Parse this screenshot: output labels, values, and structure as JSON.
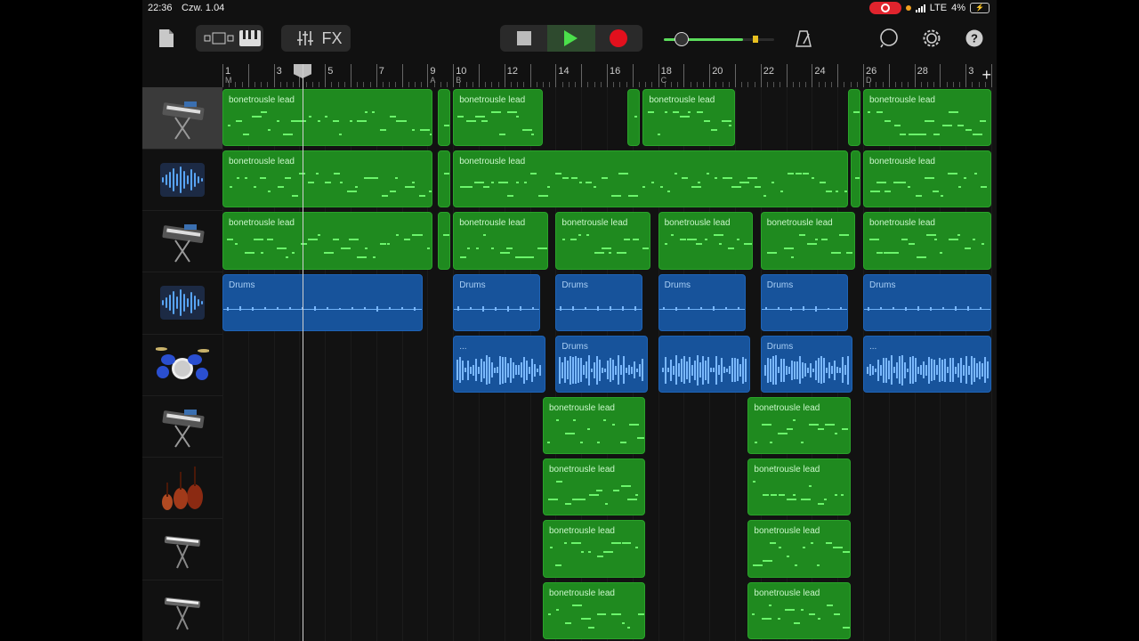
{
  "status": {
    "time": "22:36",
    "date": "Czw. 1.04",
    "network": "LTE",
    "battery": "4%"
  },
  "toolbar": {
    "fx_label": "FX",
    "volume_level": 0.72,
    "accent_color": "#3ee03e",
    "record_color": "#e3101d"
  },
  "ruler": {
    "bars": [
      "1",
      "3",
      "5",
      "7",
      "9",
      "10",
      "12",
      "14",
      "16",
      "18",
      "20",
      "22",
      "24",
      "26",
      "28",
      "3"
    ],
    "markers": [
      "M",
      "A",
      "B",
      "C",
      "D"
    ],
    "add_label": "+"
  },
  "tracks": [
    {
      "instrument_icon": "synth-keyboard-icon",
      "selected": true
    },
    {
      "instrument_icon": "audio-waveform-icon"
    },
    {
      "instrument_icon": "synth-keyboard-icon"
    },
    {
      "instrument_icon": "audio-waveform-icon"
    },
    {
      "instrument_icon": "drum-kit-icon"
    },
    {
      "instrument_icon": "synth-keyboard-icon"
    },
    {
      "instrument_icon": "string-ensemble-icon"
    },
    {
      "instrument_icon": "keyboard-stand-icon"
    },
    {
      "instrument_icon": "keyboard-stand-icon"
    }
  ],
  "regions": [
    {
      "track": 0,
      "name": "bonetrousle lead",
      "type": "midi",
      "start": 1,
      "end": 9.2
    },
    {
      "track": 0,
      "name": "",
      "type": "midi",
      "start": 9.4,
      "end": 9.9
    },
    {
      "track": 0,
      "name": "bonetrousle lead",
      "type": "midi",
      "start": 10,
      "end": 13.5
    },
    {
      "track": 0,
      "name": "",
      "type": "midi",
      "start": 16.8,
      "end": 17.3
    },
    {
      "track": 0,
      "name": "bonetrousle lead",
      "type": "midi",
      "start": 17.4,
      "end": 21
    },
    {
      "track": 0,
      "name": "",
      "type": "midi",
      "start": 25.4,
      "end": 25.9
    },
    {
      "track": 0,
      "name": "bonetrousle lead",
      "type": "midi",
      "start": 26,
      "end": 31
    },
    {
      "track": 1,
      "name": "bonetrousle lead",
      "type": "midi",
      "start": 1,
      "end": 9.2
    },
    {
      "track": 1,
      "name": "",
      "type": "midi",
      "start": 9.4,
      "end": 9.9
    },
    {
      "track": 1,
      "name": "bonetrousle lead",
      "type": "midi",
      "start": 10,
      "end": 25.4
    },
    {
      "track": 1,
      "name": "",
      "type": "midi",
      "start": 25.5,
      "end": 25.9
    },
    {
      "track": 1,
      "name": "bonetrousle lead",
      "type": "midi",
      "start": 26,
      "end": 31
    },
    {
      "track": 2,
      "name": "bonetrousle lead",
      "type": "midi",
      "start": 1,
      "end": 9.2
    },
    {
      "track": 2,
      "name": "",
      "type": "midi",
      "start": 9.4,
      "end": 9.9
    },
    {
      "track": 2,
      "name": "bonetrousle lead",
      "type": "midi",
      "start": 10,
      "end": 13.7
    },
    {
      "track": 2,
      "name": "bonetrousle lead",
      "type": "midi",
      "start": 14,
      "end": 17.7
    },
    {
      "track": 2,
      "name": "bonetrousle lead",
      "type": "midi",
      "start": 18,
      "end": 21.7
    },
    {
      "track": 2,
      "name": "bonetrousle lead",
      "type": "midi",
      "start": 22,
      "end": 25.7
    },
    {
      "track": 2,
      "name": "bonetrousle lead",
      "type": "midi",
      "start": 26,
      "end": 31
    },
    {
      "track": 3,
      "name": "Drums",
      "type": "drum",
      "style": "flat",
      "start": 1,
      "end": 8.8
    },
    {
      "track": 3,
      "name": "Drums",
      "type": "drum",
      "style": "flat",
      "start": 10,
      "end": 13.4
    },
    {
      "track": 3,
      "name": "Drums",
      "type": "drum",
      "style": "flat",
      "start": 14,
      "end": 17.4
    },
    {
      "track": 3,
      "name": "Drums",
      "type": "drum",
      "style": "flat",
      "start": 18,
      "end": 21.4
    },
    {
      "track": 3,
      "name": "Drums",
      "type": "drum",
      "style": "flat",
      "start": 22,
      "end": 25.4
    },
    {
      "track": 3,
      "name": "Drums",
      "type": "drum",
      "style": "flat",
      "start": 26,
      "end": 31
    },
    {
      "track": 4,
      "name": "...",
      "type": "drum",
      "style": "wave",
      "start": 10,
      "end": 13.6
    },
    {
      "track": 4,
      "name": "Drums",
      "type": "drum",
      "style": "wave",
      "start": 14,
      "end": 17.6
    },
    {
      "track": 4,
      "name": "",
      "type": "drum",
      "style": "wave",
      "start": 18,
      "end": 21.6
    },
    {
      "track": 4,
      "name": "Drums",
      "type": "drum",
      "style": "wave",
      "start": 22,
      "end": 25.6
    },
    {
      "track": 4,
      "name": "...",
      "type": "drum",
      "style": "wave",
      "start": 26,
      "end": 31
    },
    {
      "track": 5,
      "name": "bonetrousle lead",
      "type": "midi",
      "start": 13.5,
      "end": 17.5
    },
    {
      "track": 5,
      "name": "bonetrousle lead",
      "type": "midi",
      "start": 21.5,
      "end": 25.5
    },
    {
      "track": 6,
      "name": "bonetrousle lead",
      "type": "midi",
      "start": 13.5,
      "end": 17.5
    },
    {
      "track": 6,
      "name": "bonetrousle lead",
      "type": "midi",
      "start": 21.5,
      "end": 25.5
    },
    {
      "track": 7,
      "name": "bonetrousle lead",
      "type": "midi",
      "start": 13.5,
      "end": 17.5
    },
    {
      "track": 7,
      "name": "bonetrousle lead",
      "type": "midi",
      "start": 21.5,
      "end": 25.5
    },
    {
      "track": 8,
      "name": "bonetrousle lead",
      "type": "midi",
      "start": 13.5,
      "end": 17.5
    },
    {
      "track": 8,
      "name": "bonetrousle lead",
      "type": "midi",
      "start": 21.5,
      "end": 25.5
    }
  ]
}
